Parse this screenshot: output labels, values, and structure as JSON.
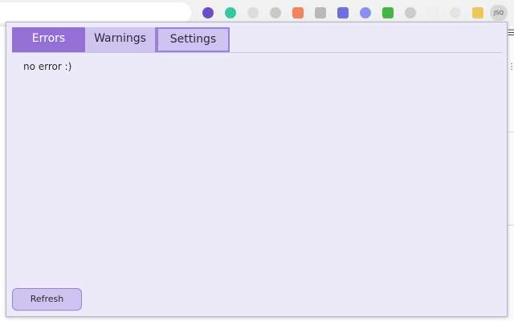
{
  "browser": {
    "active_extension_label": "JSQ",
    "extension_icons": [
      {
        "name": "ext-purple-icon",
        "color": "#6c4fc4",
        "shape": "circle"
      },
      {
        "name": "ext-teal-icon",
        "color": "#36c7a0",
        "shape": "circle"
      },
      {
        "name": "ext-grey-icon-1",
        "color": "#dcdcdc",
        "shape": "circle"
      },
      {
        "name": "ext-grey-icon-2",
        "color": "#c9c9c9",
        "shape": "circle"
      },
      {
        "name": "ext-orange-icon",
        "color": "#f4845f",
        "shape": "square"
      },
      {
        "name": "ext-grey-icon-3",
        "color": "#b9b9b9",
        "shape": "square"
      },
      {
        "name": "ext-blue-icon",
        "color": "#6e70e0",
        "shape": "square"
      },
      {
        "name": "ext-lavender-icon",
        "color": "#8c8ef0",
        "shape": "circle"
      },
      {
        "name": "ext-green-icon",
        "color": "#46b546",
        "shape": "square"
      },
      {
        "name": "ext-grey-icon-4",
        "color": "#cccccc",
        "shape": "circle"
      },
      {
        "name": "ext-outline-icon",
        "color": "#eeeeee",
        "shape": "square"
      },
      {
        "name": "ext-light-icon",
        "color": "#e4e4e4",
        "shape": "circle"
      },
      {
        "name": "ext-yellow-icon",
        "color": "#e8c95a",
        "shape": "square"
      }
    ]
  },
  "popup": {
    "tabs": [
      {
        "label": "Errors",
        "active": true
      },
      {
        "label": "Warnings",
        "active": false
      },
      {
        "label": "Settings",
        "active": false
      }
    ],
    "message": "no error :)",
    "refresh_label": "Refresh"
  },
  "colors": {
    "popup_background": "#ece9f9",
    "active_tab": "#9570d4",
    "inactive_tab": "#cfc3f1",
    "accent_border": "#9c82d6"
  }
}
